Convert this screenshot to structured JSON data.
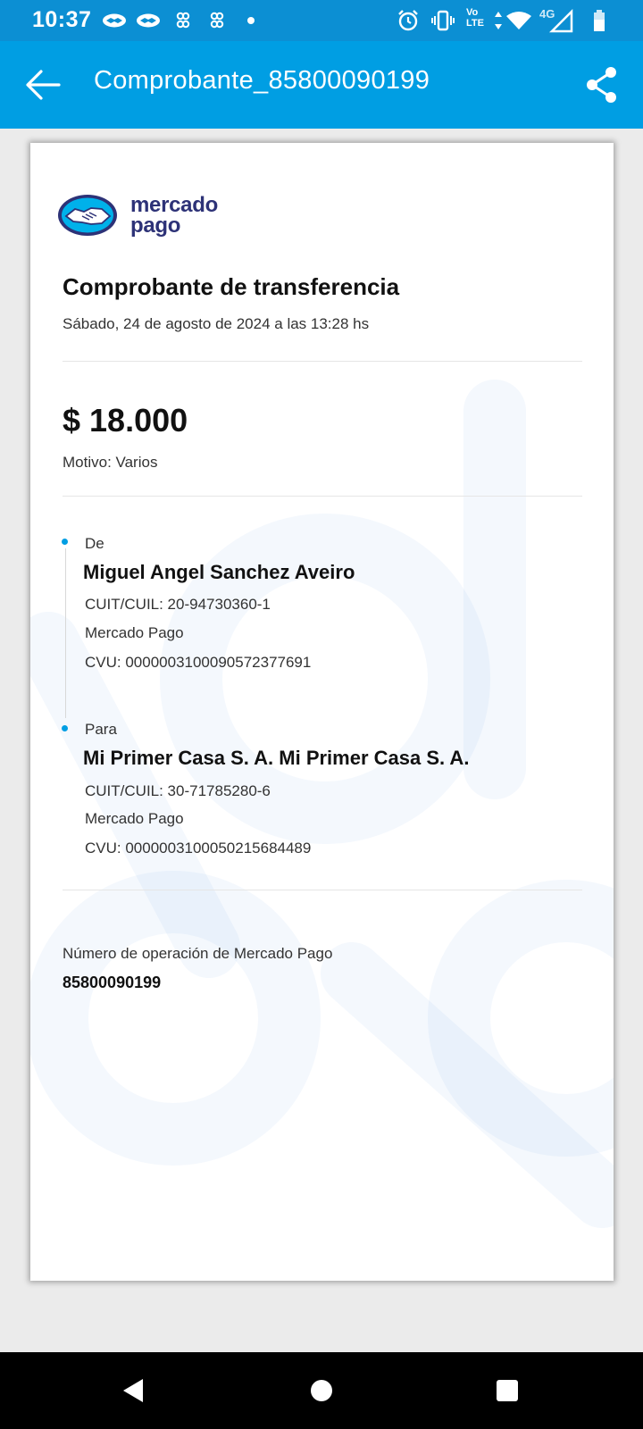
{
  "status_bar": {
    "time": "10:37",
    "notification_icons": [
      "handshake-icon",
      "handshake-icon",
      "app-icon",
      "app-icon",
      "dot-icon"
    ],
    "system_icons": [
      "alarm-icon",
      "vibrate-icon",
      "volte-icon",
      "wifi-icon",
      "signal-4g-icon",
      "battery-icon"
    ],
    "volte_label": "Vo LTE",
    "network_label": "4G"
  },
  "app_bar": {
    "title": "Comprobante_85800090199",
    "back_icon": "arrow-left-icon",
    "share_icon": "share-icon"
  },
  "receipt": {
    "brand": {
      "line1": "mercado",
      "line2": "pago"
    },
    "title": "Comprobante de transferencia",
    "datetime": "Sábado, 24 de agosto de 2024 a las 13:28 hs",
    "amount": "$ 18.000",
    "reason": "Motivo: Varios",
    "from": {
      "label": "De",
      "name": "Miguel Angel Sanchez Aveiro",
      "tax_id": "CUIT/CUIL: 20-94730360-1",
      "institution": "Mercado Pago",
      "cvu": "CVU: 0000003100090572377691"
    },
    "to": {
      "label": "Para",
      "name": "Mi Primer Casa S. A. Mi Primer Casa S. A.",
      "tax_id": "CUIT/CUIL: 30-71785280-6",
      "institution": "Mercado Pago",
      "cvu": "CVU: 0000003100050215684489"
    },
    "operation_label": "Número de operación de Mercado Pago",
    "operation_number": "85800090199"
  },
  "colors": {
    "status_bar": "#0c8fd3",
    "app_bar": "#009ee3",
    "brand_navy": "#2d3277",
    "accent_dot": "#009ee3",
    "background": "#ebebeb"
  }
}
